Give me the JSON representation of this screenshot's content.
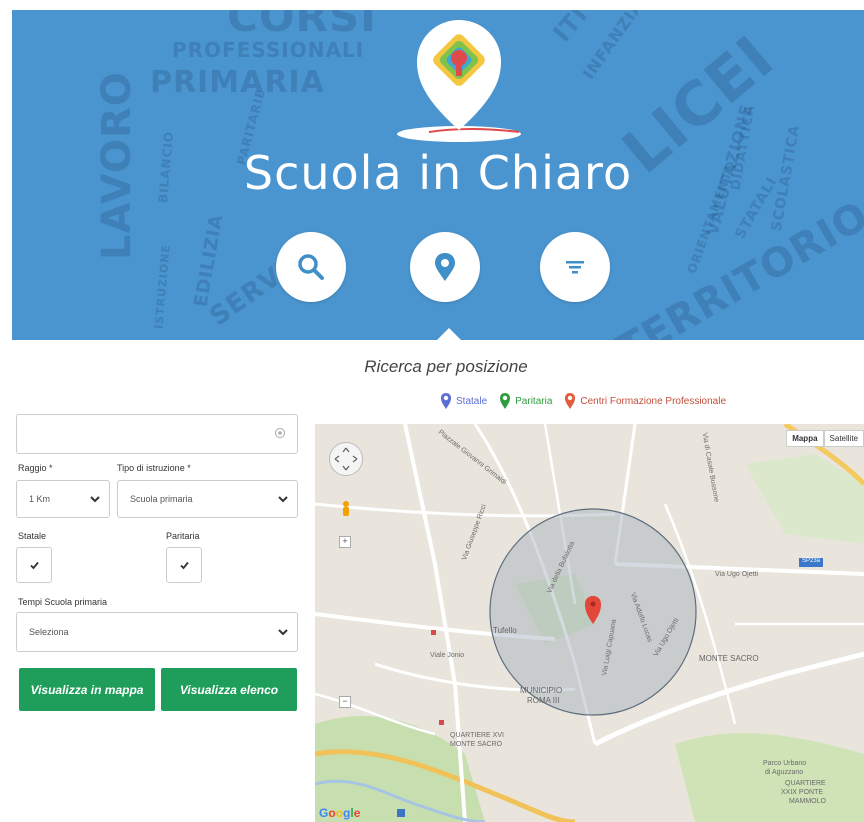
{
  "hero": {
    "title": "Scuola in Chiaro",
    "background_color": "#4a95cf",
    "word_cloud": [
      "CORSI",
      "PROFESSIONALI",
      "PRIMARIA",
      "LAVORO",
      "LICEI",
      "INFANZIA",
      "SERVIZI",
      "TERRITORIO",
      "EDILIZIA",
      "STATALI",
      "SCOLASTICA",
      "VALUTAZIONE",
      "PARITARIE",
      "BILANCIO",
      "ISTRUZIONE",
      "ORIENTAMENTO",
      "DIDATTICA",
      "ITI"
    ],
    "nav_buttons": [
      {
        "name": "search",
        "icon": "search-icon"
      },
      {
        "name": "position",
        "icon": "map-pin-icon"
      },
      {
        "name": "filter",
        "icon": "filter-icon"
      }
    ]
  },
  "search": {
    "heading": "Ricerca per posizione",
    "legend": [
      {
        "label": "Statale",
        "color": "#5b6fd6",
        "icon": "map-pin-icon"
      },
      {
        "label": "Paritaria",
        "color": "#2e9e3e",
        "icon": "map-pin-icon"
      },
      {
        "label": "Centri Formazione Professionale",
        "color": "#e25d3e",
        "icon": "map-pin-icon"
      }
    ]
  },
  "form": {
    "address_value": "",
    "address_placeholder": "",
    "raggio_label": "Raggio *",
    "raggio_value": "1 Km",
    "tipo_label": "Tipo di istruzione *",
    "tipo_value": "Scuola primaria",
    "statale_label": "Statale",
    "statale_checked": true,
    "paritaria_label": "Paritaria",
    "paritaria_checked": true,
    "tempi_label": "Tempi Scuola primaria",
    "tempi_value": "Seleziona",
    "btn_mappa": "Visualizza in mappa",
    "btn_elenco": "Visualizza elenco",
    "accent_color": "#1f9e5b"
  },
  "map": {
    "map_type_buttons": [
      "Mappa",
      "Satellite"
    ],
    "zoom_in": "+",
    "zoom_out": "−",
    "labels": {
      "via_giovanni_grimaldi": "Piazzale Giovanni Grimaldi",
      "via_giuseppe_rosso": "Via Giuseppe Ricci",
      "via_casale": "Via di Casale Bussone",
      "via_ugo_ojetti": "Via Ugo Ojetti",
      "tufello": "Tufello",
      "viale_jonio": "Viale Jonio",
      "monte_sacro": "MONTE SACRO",
      "municipio": "MUNICIPIO",
      "roma_iii": "ROMA III",
      "quartiere_xvi": "QUARTIERE XVI",
      "monte_sacro_2": "MONTE SACRO",
      "parco_urbano": "Parco Urbano",
      "di_aguzzano": "di Aguzzano",
      "quartiere_xxix": "QUARTIERE",
      "ponte_mammolo": "XXIX PONTE",
      "mammolo": "MAMMOLO",
      "via_della_bufalotta": "Via della Bufalotta",
      "via_ugo_ojetti_2": "Via Ugo Ojetti",
      "via_luigi_capuana": "Via Luigi Capuana",
      "via_adolfo_lucas": "Via Adolfo Lucas",
      "sp024": "SP23a",
      "google": "Google"
    }
  }
}
